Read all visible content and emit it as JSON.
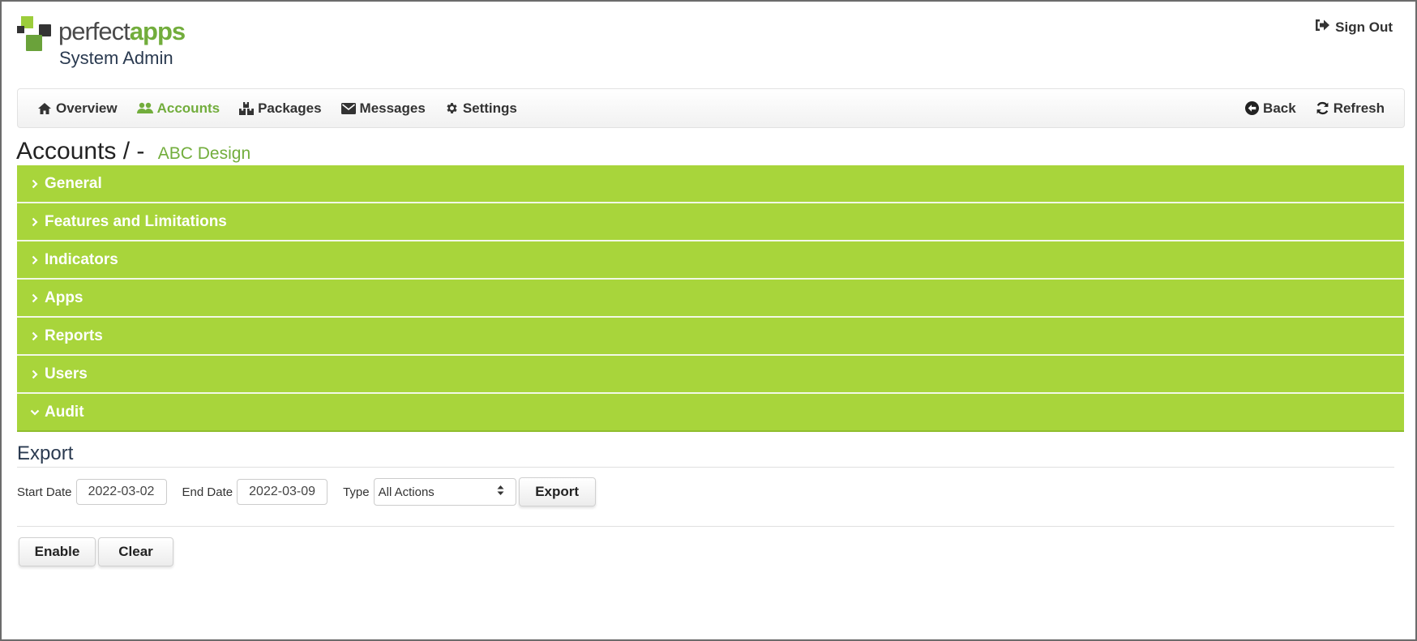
{
  "header": {
    "brand_part1": "perfect",
    "brand_part2": "apps",
    "subtitle": "System Admin",
    "sign_out_label": "Sign Out",
    "sign_out_icon": "sign-out-icon"
  },
  "colors": {
    "accent_green": "#72ad3c",
    "accordion_green": "#a8d53b"
  },
  "navbar": {
    "items": [
      {
        "label": "Overview",
        "icon": "home-icon",
        "active": false
      },
      {
        "label": "Accounts",
        "icon": "users-icon",
        "active": true
      },
      {
        "label": "Packages",
        "icon": "packages-icon",
        "active": false
      },
      {
        "label": "Messages",
        "icon": "envelope-icon",
        "active": false
      },
      {
        "label": "Settings",
        "icon": "gear-icon",
        "active": false
      }
    ],
    "right_items": [
      {
        "label": "Back",
        "icon": "arrow-circle-left-icon"
      },
      {
        "label": "Refresh",
        "icon": "refresh-icon"
      }
    ]
  },
  "page": {
    "title": "Accounts / -",
    "account_name": "ABC Design"
  },
  "accordion": {
    "sections": [
      {
        "label": "General",
        "expanded": false
      },
      {
        "label": "Features and Limitations",
        "expanded": false
      },
      {
        "label": "Indicators",
        "expanded": false
      },
      {
        "label": "Apps",
        "expanded": false
      },
      {
        "label": "Reports",
        "expanded": false
      },
      {
        "label": "Users",
        "expanded": false
      },
      {
        "label": "Audit",
        "expanded": true
      }
    ]
  },
  "audit": {
    "export_heading": "Export",
    "start_date_label": "Start Date",
    "start_date_value": "2022-03-02",
    "end_date_label": "End Date",
    "end_date_value": "2022-03-09",
    "type_label": "Type",
    "type_selected": "All Actions",
    "export_button": "Export",
    "enable_button": "Enable",
    "clear_button": "Clear"
  }
}
